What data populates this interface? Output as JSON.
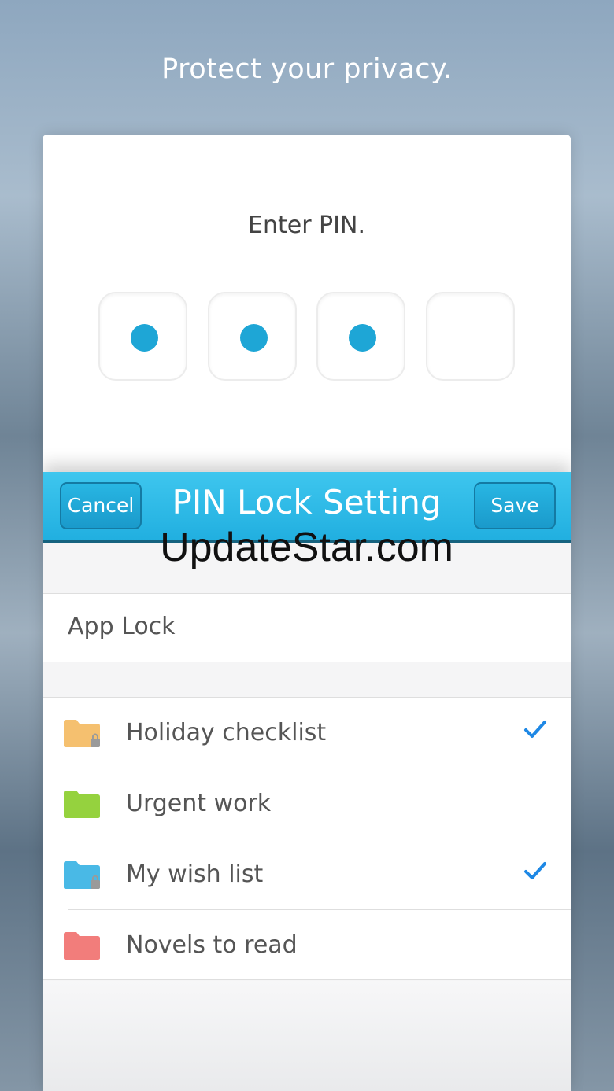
{
  "headline": "Protect your privacy.",
  "pin": {
    "label": "Enter PIN.",
    "filled": [
      true,
      true,
      true,
      false
    ]
  },
  "sheet": {
    "title": "PIN Lock Setting",
    "cancel_label": "Cancel",
    "save_label": "Save",
    "watermark": "UpdateStar.com",
    "app_lock_label": "App Lock",
    "items": [
      {
        "label": "Holiday checklist",
        "folder_color": "#f5c06f",
        "locked": true,
        "checked": true
      },
      {
        "label": "Urgent work",
        "folder_color": "#95d23e",
        "locked": false,
        "checked": false
      },
      {
        "label": "My wish list",
        "folder_color": "#49b9e6",
        "locked": true,
        "checked": true
      },
      {
        "label": "Novels to read",
        "folder_color": "#f27d7b",
        "locked": false,
        "checked": false
      }
    ]
  },
  "colors": {
    "accent": "#21afe0",
    "pin_dot": "#1ea6d6",
    "check": "#1e88e5"
  }
}
